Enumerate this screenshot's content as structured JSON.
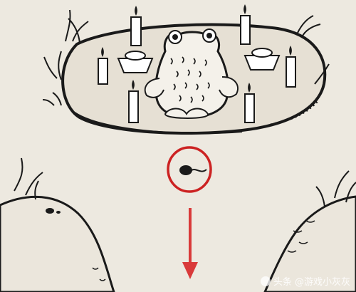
{
  "scene": {
    "background_color": "#ede9e0",
    "ink_color": "#1a1a1a",
    "highlight_color": "#cc2222",
    "arrow_color": "#d93a3a",
    "objects": [
      "altar-platform",
      "toad-idol",
      "candles",
      "gold-ingots",
      "grass-tufts",
      "tadpole",
      "selection-circle",
      "down-arrow"
    ]
  },
  "watermark": {
    "text": "头条 @游戏小灰灰",
    "icon": "toutiao-logo-icon"
  }
}
